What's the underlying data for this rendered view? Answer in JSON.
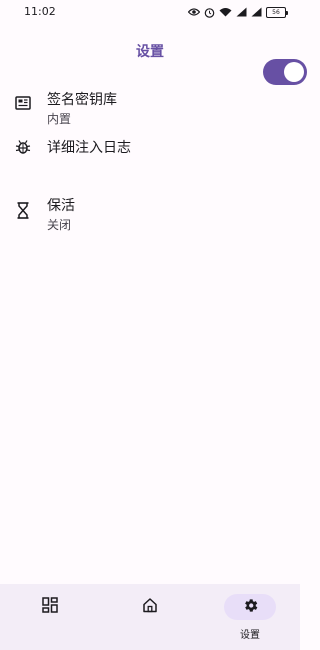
{
  "status_bar": {
    "time": "11:02",
    "icons": [
      "eye-icon",
      "alarm-icon",
      "wifi-icon",
      "signal-icon",
      "signal-icon",
      "battery-icon"
    ],
    "battery_level": "56"
  },
  "header": {
    "title": "设置"
  },
  "settings": {
    "items": [
      {
        "icon": "keystore-icon",
        "title": "签名密钥库",
        "subtitle": "内置"
      },
      {
        "icon": "bug-icon",
        "title": "详细注入日志",
        "toggle_on": true
      },
      {
        "icon": "hourglass-icon",
        "title": "保活",
        "subtitle": "关闭"
      }
    ]
  },
  "bottom_nav": {
    "items": [
      {
        "icon": "grid-icon",
        "label": "",
        "active": false
      },
      {
        "icon": "home-icon",
        "label": "",
        "active": false
      },
      {
        "icon": "gear-icon",
        "label": "设置",
        "active": true
      }
    ]
  },
  "colors": {
    "accent": "#6750a4",
    "background": "#fffbfe",
    "nav_background": "#f3edf7",
    "active_pill": "#e8def8"
  }
}
